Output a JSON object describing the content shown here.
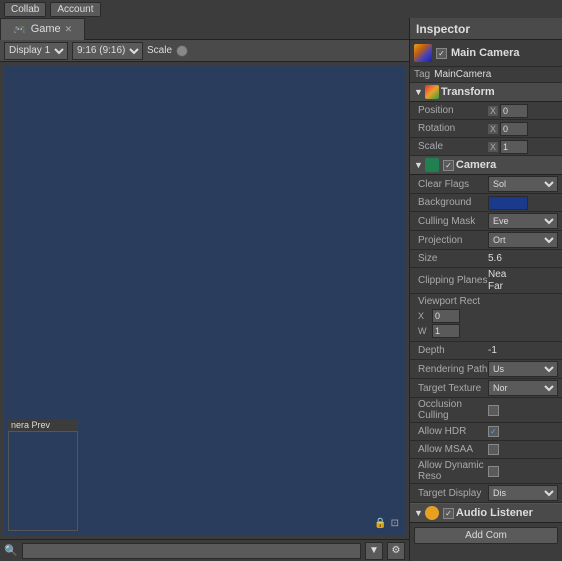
{
  "topbar": {
    "collab_label": "Collab",
    "account_label": "Account"
  },
  "game_panel": {
    "tab_label": "Game",
    "display_label": "Display 1",
    "resolution_label": "9:16 (9:16)",
    "scale_label": "Scale",
    "search_placeholder": "",
    "camera_preview_label": "nera Prev"
  },
  "inspector": {
    "title": "Inspector",
    "object_name": "Main Camera",
    "tag_label": "Tag",
    "tag_value": "MainCamera",
    "transform": {
      "section_title": "Transform",
      "position_label": "Position",
      "pos_x": "0",
      "rotation_label": "Rotation",
      "rot_x": "0",
      "scale_label": "Scale",
      "scale_x": "1"
    },
    "camera": {
      "section_title": "Camera",
      "clear_flags_label": "Clear Flags",
      "clear_flags_value": "Sol",
      "background_label": "Background",
      "culling_mask_label": "Culling Mask",
      "culling_mask_value": "Eve",
      "projection_label": "Projection",
      "projection_value": "Ort",
      "size_label": "Size",
      "size_value": "5.6",
      "clipping_label": "Clipping Planes",
      "clipping_near": "Nea",
      "clipping_far": "Far",
      "viewport_label": "Viewport Rect",
      "vp_x_label": "X",
      "vp_x_value": "0",
      "vp_w_label": "W",
      "vp_w_value": "1",
      "depth_label": "Depth",
      "depth_value": "-1",
      "rendering_label": "Rendering Path",
      "rendering_value": "Us",
      "target_texture_label": "Target Texture",
      "target_texture_value": "Nor",
      "occlusion_label": "Occlusion Culling",
      "allow_hdr_label": "Allow HDR",
      "allow_msaa_label": "Allow MSAA",
      "allow_dynamic_label": "Allow Dynamic Reso",
      "target_display_label": "Target Display",
      "target_display_value": "Dis"
    },
    "audio_listener": {
      "section_title": "Audio Listener"
    },
    "add_component_label": "Add Com"
  }
}
